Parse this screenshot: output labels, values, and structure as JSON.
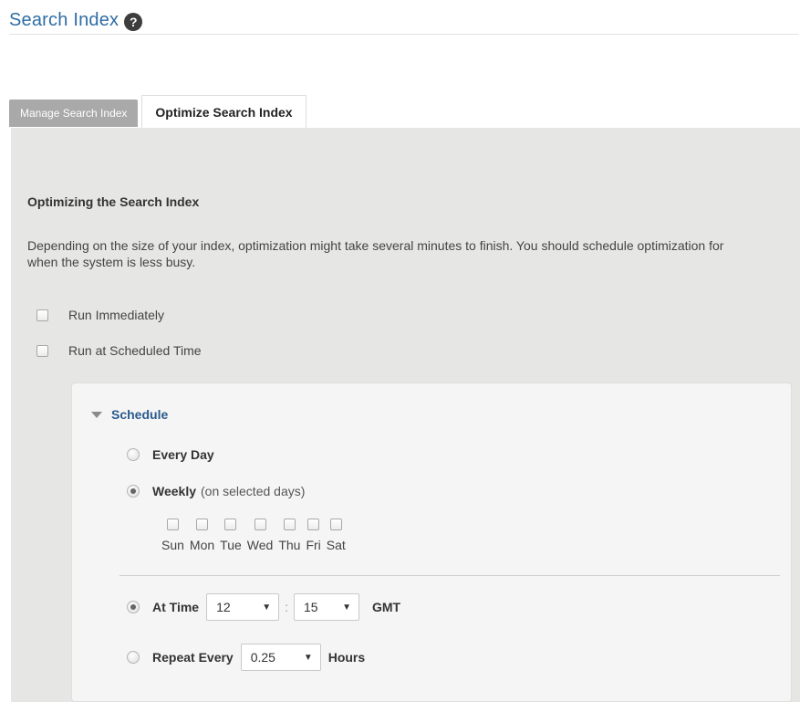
{
  "header": {
    "title": "Search Index",
    "help_icon": "?"
  },
  "tabs": [
    {
      "label": "Manage Search Index",
      "active": false
    },
    {
      "label": "Optimize Search Index",
      "active": true
    }
  ],
  "section": {
    "heading": "Optimizing the Search Index",
    "description": "Depending on the size of your index, optimization might take several minutes to finish. You should schedule optimization for when the system is less busy."
  },
  "options": {
    "run_immediately": "Run Immediately",
    "run_scheduled": "Run at Scheduled Time"
  },
  "schedule": {
    "label": "Schedule",
    "every_day": "Every Day",
    "weekly": "Weekly",
    "weekly_note": "(on selected days)",
    "days": [
      "Sun",
      "Mon",
      "Tue",
      "Wed",
      "Thu",
      "Fri",
      "Sat"
    ],
    "at_time_label": "At Time",
    "hour": "12",
    "colon": ":",
    "minute": "15",
    "timezone": "GMT",
    "repeat_label": "Repeat Every",
    "repeat_value": "0.25",
    "repeat_unit": "Hours"
  }
}
